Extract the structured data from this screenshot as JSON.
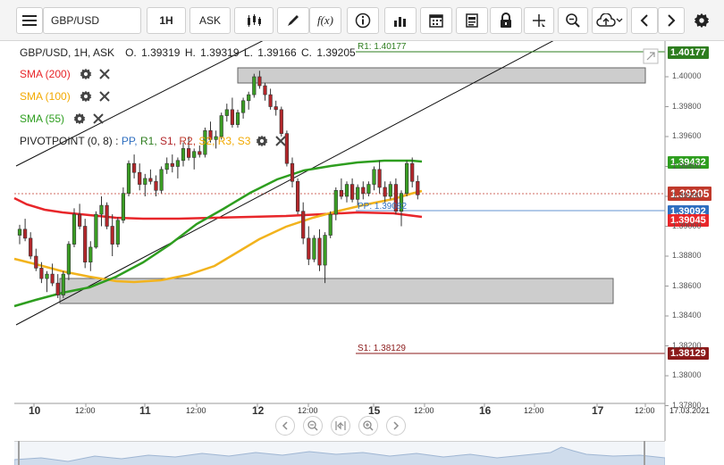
{
  "toolbar": {
    "symbol": "GBP/USD",
    "timeframe": "1H",
    "price_type": "ASK",
    "fx_label": "f(x)"
  },
  "ohlc": {
    "pair_info": "GBP/USD, 1H, ASK",
    "open_label": "O.",
    "open": "1.39319",
    "high_label": "H.",
    "high": "1.39319",
    "low_label": "L.",
    "low": "1.39166",
    "close_label": "C.",
    "close": "1.39205"
  },
  "indicators": {
    "sma200": {
      "label": "SMA (200)",
      "color": "#e8262a"
    },
    "sma100": {
      "label": "SMA (100)",
      "color": "#f2b31d"
    },
    "sma55": {
      "label": "SMA (55)",
      "color": "#2e9e1f"
    },
    "pivot": {
      "label": "PIVOTPOINT (0, 8)",
      "sep": ":",
      "pp": "PP,",
      "r1": "R1,",
      "s1": "S1,",
      "r2": "R2,",
      "s2": "S2,",
      "r3": "R3,",
      "s3": "S3"
    }
  },
  "levels": {
    "r1_label": "R1: 1.40177",
    "s1_label": "S1: 1.38129",
    "pp_label": "PP: 1.39082"
  },
  "price_tags": {
    "r1": "1.40177",
    "sma55": "1.39432",
    "current": "1.39205",
    "pp": "1.39092",
    "sma200": "1.39045",
    "s1": "1.38129"
  },
  "colors": {
    "r1": "#2e7d1f",
    "s1": "#8b1a1a",
    "pp": "#2f6fc0",
    "current": "#c0392b",
    "sma200": "#e8262a",
    "sma100": "#f2b31d",
    "sma55": "#2e9e1f",
    "bull": "#3a9d23",
    "bear": "#b3262a"
  },
  "chart_data": {
    "type": "candlestick",
    "y_axis": {
      "ticks": [
        "1.40000",
        "1.39800",
        "1.39600",
        "1.39400",
        "1.39200",
        "1.39000",
        "1.38800",
        "1.38600",
        "1.38400",
        "1.38200",
        "1.38000",
        "1.37800"
      ],
      "ylim": [
        1.3775,
        1.4025
      ]
    },
    "x_axis": {
      "ticks": [
        "10",
        "12:00",
        "11",
        "12:00",
        "12",
        "12:00",
        "15",
        "12:00",
        "16",
        "12:00",
        "17",
        "12:00",
        "17.03.2021"
      ]
    },
    "candles": [
      [
        1.3894,
        1.3901,
        1.3888,
        1.3898
      ],
      [
        1.3898,
        1.3905,
        1.389,
        1.3892
      ],
      [
        1.3892,
        1.3896,
        1.3878,
        1.388
      ],
      [
        1.388,
        1.3885,
        1.387,
        1.3872
      ],
      [
        1.3872,
        1.3876,
        1.3862,
        1.3865
      ],
      [
        1.3865,
        1.387,
        1.3856,
        1.3868
      ],
      [
        1.3868,
        1.3875,
        1.386,
        1.3862
      ],
      [
        1.3862,
        1.3868,
        1.3852,
        1.3854
      ],
      [
        1.3854,
        1.387,
        1.3852,
        1.3868
      ],
      [
        1.3868,
        1.389,
        1.3864,
        1.3888
      ],
      [
        1.3888,
        1.3912,
        1.3886,
        1.3908
      ],
      [
        1.3908,
        1.3915,
        1.3898,
        1.39
      ],
      [
        1.39,
        1.3905,
        1.3872,
        1.3876
      ],
      [
        1.3876,
        1.389,
        1.387,
        1.3886
      ],
      [
        1.3886,
        1.391,
        1.3885,
        1.3908
      ],
      [
        1.3908,
        1.392,
        1.39,
        1.3914
      ],
      [
        1.3914,
        1.3916,
        1.3898,
        1.39
      ],
      [
        1.39,
        1.3908,
        1.388,
        1.3888
      ],
      [
        1.3888,
        1.3906,
        1.3886,
        1.3904
      ],
      [
        1.3904,
        1.3926,
        1.3902,
        1.3922
      ],
      [
        1.3922,
        1.3944,
        1.392,
        1.3942
      ],
      [
        1.3942,
        1.3948,
        1.3932,
        1.3936
      ],
      [
        1.3936,
        1.3942,
        1.3924,
        1.3928
      ],
      [
        1.3928,
        1.3935,
        1.392,
        1.3932
      ],
      [
        1.3932,
        1.3938,
        1.3928,
        1.393
      ],
      [
        1.393,
        1.3934,
        1.392,
        1.3924
      ],
      [
        1.3924,
        1.394,
        1.3922,
        1.3938
      ],
      [
        1.3938,
        1.3946,
        1.3935,
        1.3942
      ],
      [
        1.3942,
        1.3948,
        1.3936,
        1.394
      ],
      [
        1.394,
        1.3946,
        1.3932,
        1.3944
      ],
      [
        1.3944,
        1.3956,
        1.394,
        1.3952
      ],
      [
        1.3952,
        1.396,
        1.3944,
        1.3946
      ],
      [
        1.3946,
        1.3952,
        1.3938,
        1.395
      ],
      [
        1.395,
        1.3954,
        1.3946,
        1.3948
      ],
      [
        1.3948,
        1.3966,
        1.3946,
        1.3964
      ],
      [
        1.3964,
        1.397,
        1.3956,
        1.3958
      ],
      [
        1.3958,
        1.3964,
        1.3952,
        1.396
      ],
      [
        1.396,
        1.3976,
        1.3958,
        1.3974
      ],
      [
        1.3974,
        1.3982,
        1.397,
        1.3978
      ],
      [
        1.3978,
        1.3986,
        1.3966,
        1.3968
      ],
      [
        1.3968,
        1.3978,
        1.3966,
        1.3976
      ],
      [
        1.3976,
        1.3986,
        1.3972,
        1.3984
      ],
      [
        1.3984,
        1.399,
        1.3978,
        1.3988
      ],
      [
        1.3988,
        1.4002,
        1.3986,
        1.4
      ],
      [
        1.4,
        1.4004,
        1.3992,
        1.3994
      ],
      [
        1.3994,
        1.3996,
        1.3984,
        1.3988
      ],
      [
        1.3988,
        1.3992,
        1.3978,
        1.398
      ],
      [
        1.398,
        1.3984,
        1.3974,
        1.3978
      ],
      [
        1.3978,
        1.398,
        1.396,
        1.3962
      ],
      [
        1.3962,
        1.3964,
        1.394,
        1.3942
      ],
      [
        1.3942,
        1.3946,
        1.3926,
        1.393
      ],
      [
        1.393,
        1.3932,
        1.3908,
        1.391
      ],
      [
        1.391,
        1.3916,
        1.3888,
        1.3892
      ],
      [
        1.3892,
        1.39,
        1.3874,
        1.3878
      ],
      [
        1.3878,
        1.3894,
        1.3876,
        1.3892
      ],
      [
        1.3892,
        1.3898,
        1.387,
        1.3874
      ],
      [
        1.3874,
        1.3896,
        1.3862,
        1.3894
      ],
      [
        1.3894,
        1.391,
        1.3892,
        1.3908
      ],
      [
        1.3908,
        1.3926,
        1.3904,
        1.3924
      ],
      [
        1.3924,
        1.3932,
        1.3918,
        1.392
      ],
      [
        1.392,
        1.393,
        1.3916,
        1.3928
      ],
      [
        1.3928,
        1.3932,
        1.3916,
        1.3918
      ],
      [
        1.3918,
        1.3928,
        1.3914,
        1.3926
      ],
      [
        1.3926,
        1.393,
        1.3918,
        1.3922
      ],
      [
        1.3922,
        1.393,
        1.392,
        1.3928
      ],
      [
        1.3928,
        1.394,
        1.3924,
        1.3938
      ],
      [
        1.3938,
        1.3944,
        1.3922,
        1.3926
      ],
      [
        1.3926,
        1.393,
        1.3916,
        1.392
      ],
      [
        1.392,
        1.393,
        1.3918,
        1.3928
      ],
      [
        1.3928,
        1.3932,
        1.3908,
        1.391
      ],
      [
        1.391,
        1.3924,
        1.39,
        1.3922
      ],
      [
        1.3922,
        1.3944,
        1.392,
        1.3942
      ],
      [
        1.3942,
        1.3946,
        1.3926,
        1.393
      ],
      [
        1.393,
        1.3934,
        1.3918,
        1.3921
      ]
    ]
  }
}
